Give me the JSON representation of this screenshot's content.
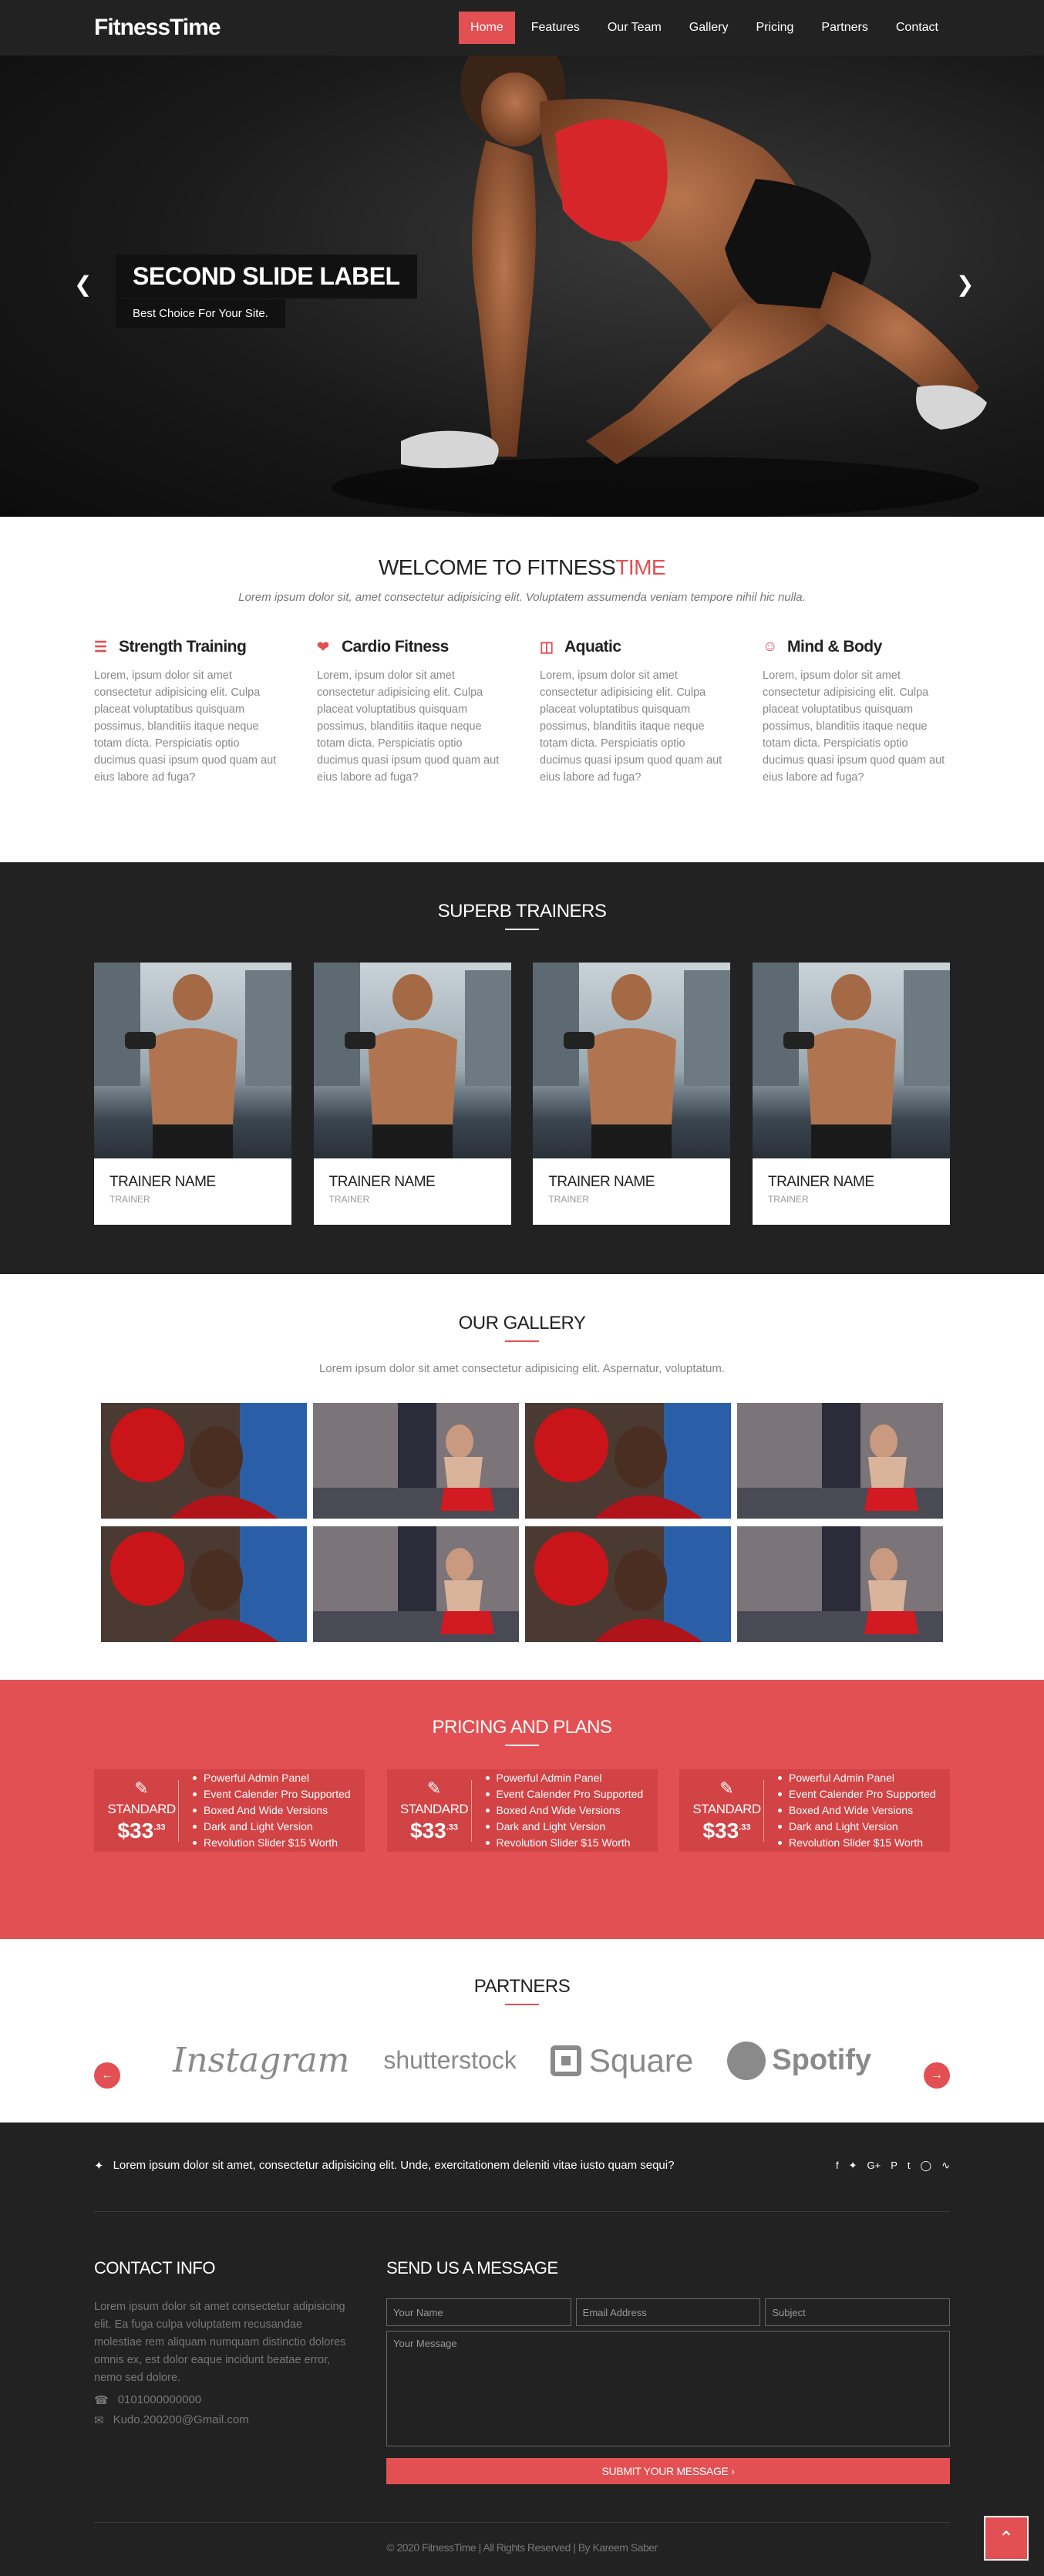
{
  "nav": {
    "brand": "FitnessTime",
    "items": [
      {
        "label": "Home",
        "active": true
      },
      {
        "label": "Features"
      },
      {
        "label": "Our Team"
      },
      {
        "label": "Gallery"
      },
      {
        "label": "Pricing"
      },
      {
        "label": "Partners"
      },
      {
        "label": "Contact"
      }
    ]
  },
  "hero": {
    "title": "SECOND SLIDE LABEL",
    "subtitle": "Best Choice For Your Site.",
    "prev_icon": "chevron-left-icon",
    "next_icon": "chevron-right-icon"
  },
  "welcome": {
    "title_main": "WELCOME TO FITNESS",
    "title_accent": "TIME",
    "lead": "Lorem ipsum dolor sit, amet consectetur adipisicing elit. Voluptatem assumenda veniam tempore nihil hic nulla.",
    "features": [
      {
        "icon": "list-icon",
        "title": "Strength Training",
        "text": "Lorem, ipsum dolor sit amet consectetur adipisicing elit. Culpa placeat voluptatibus quisquam possimus, blanditiis itaque neque totam dicta. Perspiciatis optio ducimus quasi ipsum quod quam aut eius labore ad fuga?"
      },
      {
        "icon": "heartbeat-icon",
        "title": "Cardio Fitness",
        "text": "Lorem, ipsum dolor sit amet consectetur adipisicing elit. Culpa placeat voluptatibus quisquam possimus, blanditiis itaque neque totam dicta. Perspiciatis optio ducimus quasi ipsum quod quam aut eius labore ad fuga?"
      },
      {
        "icon": "trash-icon",
        "title": "Aquatic",
        "text": "Lorem, ipsum dolor sit amet consectetur adipisicing elit. Culpa placeat voluptatibus quisquam possimus, blanditiis itaque neque totam dicta. Perspiciatis optio ducimus quasi ipsum quod quam aut eius labore ad fuga?"
      },
      {
        "icon": "users-icon",
        "title": "Mind & Body",
        "text": "Lorem, ipsum dolor sit amet consectetur adipisicing elit. Culpa placeat voluptatibus quisquam possimus, blanditiis itaque neque totam dicta. Perspiciatis optio ducimus quasi ipsum quod quam aut eius labore ad fuga?"
      }
    ]
  },
  "trainers": {
    "title": "SUPERB TRAINERS",
    "items": [
      {
        "name": "TRAINER NAME",
        "role": "TRAINER"
      },
      {
        "name": "TRAINER NAME",
        "role": "TRAINER"
      },
      {
        "name": "TRAINER NAME",
        "role": "TRAINER"
      },
      {
        "name": "TRAINER NAME",
        "role": "TRAINER"
      }
    ]
  },
  "gallery": {
    "title": "OUR GALLERY",
    "lead": "Lorem ipsum dolor sit amet consectetur adipisicing elit. Aspernatur, voluptatum.",
    "images": [
      "boxer-photo",
      "kickboxer-photo",
      "boxer-photo",
      "kickboxer-photo",
      "boxer-photo",
      "kickboxer-photo",
      "boxer-photo",
      "kickboxer-photo"
    ]
  },
  "pricing": {
    "title": "PRICING AND PLANS",
    "plans": [
      {
        "name": "STANDARD",
        "price": "$33",
        "cents": ".33",
        "features": [
          "Powerful Admin Panel",
          "Event Calender Pro Supported",
          "Boxed And Wide Versions",
          "Dark and Light Version",
          "Revolution Slider $15 Worth"
        ]
      },
      {
        "name": "STANDARD",
        "price": "$33",
        "cents": ".33",
        "features": [
          "Powerful Admin Panel",
          "Event Calender Pro Supported",
          "Boxed And Wide Versions",
          "Dark and Light Version",
          "Revolution Slider $15 Worth"
        ]
      },
      {
        "name": "STANDARD",
        "price": "$33",
        "cents": ".33",
        "features": [
          "Powerful Admin Panel",
          "Event Calender Pro Supported",
          "Boxed And Wide Versions",
          "Dark and Light Version",
          "Revolution Slider $15 Worth"
        ]
      }
    ]
  },
  "partners": {
    "title": "PARTNERS",
    "logos": [
      "Instagram",
      "shutterstock",
      "Square",
      "Spotify"
    ]
  },
  "footer": {
    "tweet": "Lorem ipsum dolor sit amet, consectetur adipisicing elit. Unde, exercitationem deleniti vitae iusto quam sequi?",
    "socials": [
      "facebook-icon",
      "twitter-icon",
      "google-plus-icon",
      "pinterest-icon",
      "tumblr-icon",
      "instagram-icon",
      "rss-icon"
    ],
    "contact_title": "CONTACT INFO",
    "contact_text": "Lorem ipsum dolor sit amet consectetur adipisicing elit. Ea fuga culpa voluptatem recusandae molestiae rem aliquam numquam distinctio dolores omnis ex, est dolor eaque incidunt beatae error, nemo sed dolore.",
    "phone": "0101000000000",
    "email": "Kudo.200200@Gmail.com",
    "form_title": "SEND US A MESSAGE",
    "name_placeholder": "Your Name",
    "email_placeholder": "Email Address",
    "subject_placeholder": "Subject",
    "message_placeholder": "Your Message",
    "submit_label": "SUBMIT YOUR MESSAGE",
    "copyright": "© 2020 FitnessTime | All Rights Reserved | By Kareem Saber"
  },
  "colors": {
    "accent": "#e25053",
    "dark": "#222222"
  }
}
